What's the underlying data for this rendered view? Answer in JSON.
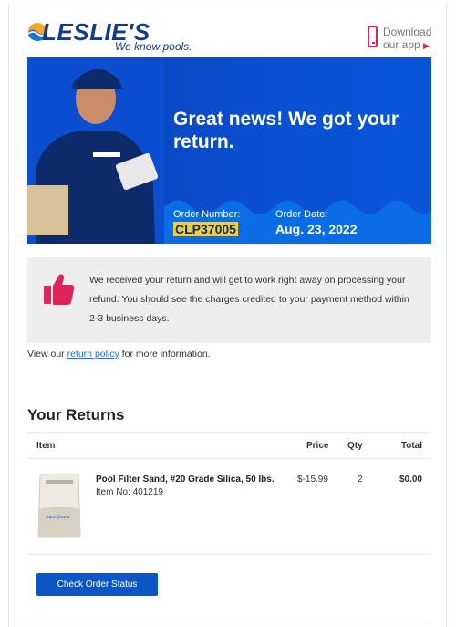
{
  "brand": {
    "logo_text": "LESLIE'S",
    "tagline": "We know pools."
  },
  "app_link": {
    "line1": "Download",
    "line2": "our app",
    "arrow_icon": "caret-right-icon"
  },
  "hero": {
    "title": "Great news! We got your return.",
    "order_number_label": "Order Number:",
    "order_number": "CLP37005",
    "order_date_label": "Order Date:",
    "order_date": "Aug. 23, 2022"
  },
  "notice": {
    "text": "We received your return and will get to work right away on processing your refund. You should see the charges credited to your payment method within 2-3 business days.",
    "icon": "thumbs-up-icon"
  },
  "policy": {
    "prefix": "View our ",
    "link": "return policy",
    "suffix": " for more information."
  },
  "returns": {
    "title": "Your Returns",
    "columns": {
      "item": "Item",
      "price": "Price",
      "qty": "Qty",
      "total": "Total"
    },
    "items": [
      {
        "name": "Pool Filter Sand, #20 Grade Silica, 50 lbs.",
        "sku": "Item No: 401219",
        "price": "$-15.99",
        "qty": "2",
        "total": "$0.00"
      }
    ]
  },
  "cta": {
    "label": "Check Order Status"
  },
  "colors": {
    "brand_blue": "#0b4fd0",
    "accent_pink": "#e0245e",
    "highlight": "#f4cd3a",
    "button_blue": "#0b56c4"
  }
}
